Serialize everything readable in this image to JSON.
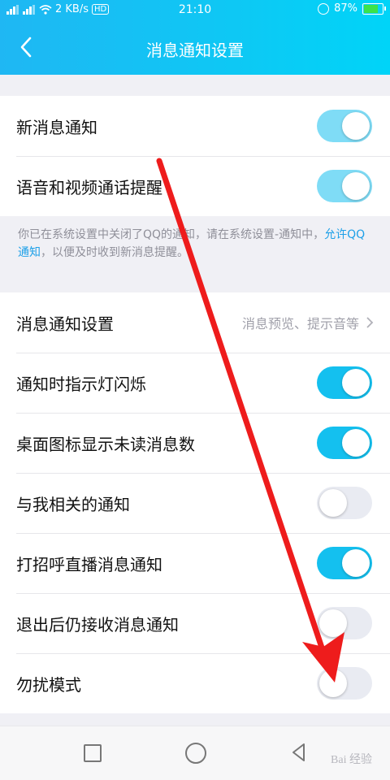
{
  "status_bar": {
    "network_speed": "2 KB/s",
    "hd_badge": "HD",
    "time": "21:10",
    "battery": "87%"
  },
  "header": {
    "title": "消息通知设置"
  },
  "group1": [
    {
      "label": "新消息通知",
      "toggle": "on"
    },
    {
      "label": "语音和视频通话提醒",
      "toggle": "on"
    }
  ],
  "notice": {
    "text_before": "你已在系统设置中关闭了QQ的通知，请在系统设置-通知中，",
    "link": "允许QQ通知",
    "text_after": "，以便及时收到新消息提醒。"
  },
  "group2": {
    "settings_row": {
      "label": "消息通知设置",
      "value": "消息预览、提示音等"
    },
    "rows": [
      {
        "label": "通知时指示灯闪烁",
        "toggle": "on"
      },
      {
        "label": "桌面图标显示未读消息数",
        "toggle": "on"
      },
      {
        "label": "与我相关的通知",
        "toggle": "off"
      },
      {
        "label": "打招呼直播消息通知",
        "toggle": "on"
      },
      {
        "label": "退出后仍接收消息通知",
        "toggle": "off"
      },
      {
        "label": "勿扰模式",
        "toggle": "off"
      }
    ]
  },
  "watermark": "Bai 经验",
  "colors": {
    "accent": "#14c0ef",
    "arrow": "#ee1c1c"
  }
}
